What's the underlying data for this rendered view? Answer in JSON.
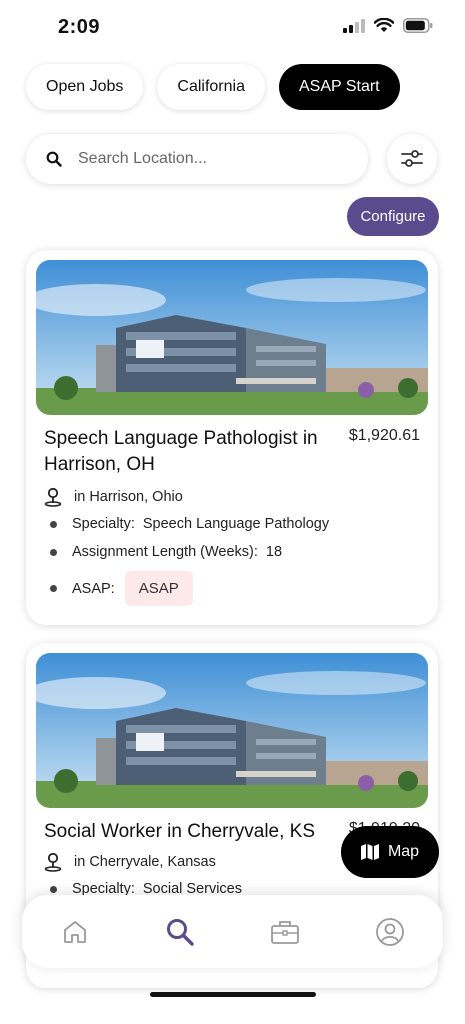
{
  "status": {
    "time": "2:09"
  },
  "filters": {
    "chips": [
      {
        "label": "Open Jobs",
        "active": false
      },
      {
        "label": "California",
        "active": false
      },
      {
        "label": "ASAP Start",
        "active": true
      }
    ]
  },
  "search": {
    "placeholder": "Search Location..."
  },
  "configure_label": "Configure",
  "jobs": [
    {
      "title": "Speech Language Pathologist in Harrison, OH",
      "price": "$1,920.61",
      "location": "in Harrison, Ohio",
      "specialty_label": "Specialty:",
      "specialty": "Speech Language Pathology",
      "assignment_label": "Assignment Length (Weeks):",
      "assignment_weeks": "18",
      "asap_label": "ASAP:",
      "asap_value": "ASAP"
    },
    {
      "title": "Social Worker in Cherryvale, KS",
      "price": "$1,919.20",
      "location": "in Cherryvale, Kansas",
      "specialty_label": "Specialty:",
      "specialty": "Social Services"
    }
  ],
  "map_label": "Map",
  "tabs": [
    {
      "name": "home",
      "icon": "home-icon",
      "active": false
    },
    {
      "name": "search",
      "icon": "search-icon",
      "active": true
    },
    {
      "name": "jobs",
      "icon": "briefcase-icon",
      "active": false
    },
    {
      "name": "profile",
      "icon": "user-circle-icon",
      "active": false
    }
  ],
  "colors": {
    "accent": "#5a4b8e",
    "asap_bg": "#fde9ea",
    "tab_active": "#5a4b8e",
    "tab_inactive": "#9a9a9a"
  }
}
